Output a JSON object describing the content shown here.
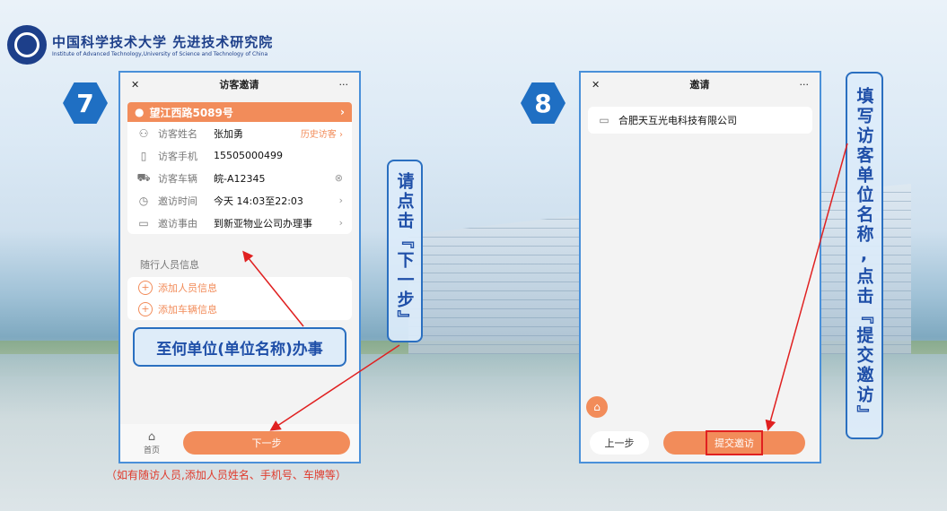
{
  "institute": {
    "name_cn": "中国科学技术大学 先进技术研究院",
    "name_en": "Institute of Advanced Technology,University of Science and Technology of China"
  },
  "step7": {
    "badge": "7",
    "window": {
      "close": "✕",
      "title": "访客邀请",
      "more": "···"
    },
    "address": "望江西路5089号",
    "address_chevron": "›",
    "fields": [
      {
        "icon": "person-icon",
        "label": "访客姓名",
        "value": "张加勇",
        "right": "历史访客 ›"
      },
      {
        "icon": "phone-icon",
        "label": "访客手机",
        "value": "15505000499",
        "right": ""
      },
      {
        "icon": "car-icon",
        "label": "访客车辆",
        "value": "皖-A12345",
        "right": "⊗"
      },
      {
        "icon": "clock-icon",
        "label": "邀访时间",
        "value": "今天 14:03至22:03",
        "right": "›"
      },
      {
        "icon": "briefcase-icon",
        "label": "邀访事由",
        "value": "到新亚物业公司办理事",
        "right": "›"
      }
    ],
    "companion_title": "随行人员信息",
    "add_person": "添加人员信息",
    "add_vehicle": "添加车辆信息",
    "home_label": "首页",
    "next_button": "下一步",
    "note": "（如有随访人员,添加人员姓名、手机号、车牌等）"
  },
  "callout_visit": "至何单位(单位名称)办事",
  "callout_next": "请点击『下一步』",
  "step8": {
    "badge": "8",
    "window": {
      "close": "✕",
      "title": "邀请",
      "more": "···"
    },
    "company": "合肥天互光电科技有限公司",
    "prev_button": "上一步",
    "submit_button": "提交邀访"
  },
  "callout_fill": "填写访客单位名称,点击『提交邀访』",
  "colors": {
    "accent": "#f28c5a",
    "frame": "#4a90d9",
    "callout": "#2a6fc0",
    "arrow": "#e02020"
  }
}
